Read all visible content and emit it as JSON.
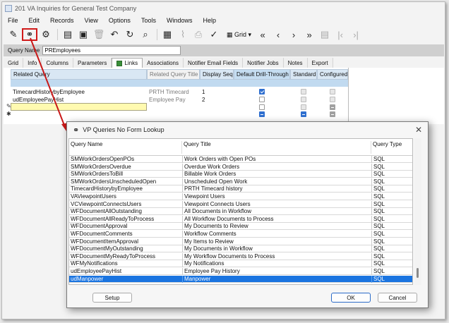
{
  "window": {
    "title": "201 VA Inquiries for General Test Company"
  },
  "menu": [
    "File",
    "Edit",
    "Records",
    "View",
    "Options",
    "Tools",
    "Windows",
    "Help"
  ],
  "toolbar": {
    "grid_label": "Grid"
  },
  "query_name": {
    "label": "Query Name",
    "value": "PREmployees"
  },
  "tabs": [
    "Grid",
    "Info",
    "Columns",
    "Parameters",
    "Links",
    "Associations",
    "Notifier Email Fields",
    "Notifier Jobs",
    "Notes",
    "Export"
  ],
  "links_grid": {
    "headers": [
      "Related Query",
      "Related Query Title",
      "Display Seq",
      "Default Drill-Through",
      "Standard",
      "Configured"
    ],
    "rows": [
      {
        "query": "TimecardHistorybyEmployee",
        "title": "PRTH Timecard",
        "seq": "1"
      },
      {
        "query": "udEmployeePayHist",
        "title": "Employee Pay",
        "seq": "2"
      }
    ]
  },
  "dialog": {
    "title": "VP Queries No Form Lookup",
    "headers": [
      "Query Name",
      "Query Title",
      "Query Type"
    ],
    "rows": [
      {
        "name": "SMWorkOrdersOpenPOs",
        "title": "Work Orders with Open POs",
        "type": "SQL"
      },
      {
        "name": "SMWorkOrdersOverdue",
        "title": "Overdue Work Orders",
        "type": "SQL"
      },
      {
        "name": "SMWorkOrdersToBill",
        "title": "Billable Work Orders",
        "type": "SQL"
      },
      {
        "name": "SMWorkOrdersUnscheduledOpen",
        "title": "Unscheduled Open Work",
        "type": "SQL"
      },
      {
        "name": "TimecardHistorybyEmployee",
        "title": "PRTH Timecard history",
        "type": "SQL"
      },
      {
        "name": "VAViewpointUsers",
        "title": "Viewpoint Users",
        "type": "SQL"
      },
      {
        "name": "VCViewpointConnectsUsers",
        "title": "Viewpoint Connects Users",
        "type": "SQL"
      },
      {
        "name": "WFDocumentAllOutstanding",
        "title": "All Documents in Workflow",
        "type": "SQL"
      },
      {
        "name": "WFDocumentAllReadyToProcess",
        "title": "All Workflow Documents to Process",
        "type": "SQL"
      },
      {
        "name": "WFDocumentApproval",
        "title": "My Documents to Review",
        "type": "SQL"
      },
      {
        "name": "WFDocumentComments",
        "title": "Workflow Comments",
        "type": "SQL"
      },
      {
        "name": "WFDocumentItemApproval",
        "title": "My Items to Review",
        "type": "SQL"
      },
      {
        "name": "WFDocumentMyOutstanding",
        "title": "My Documents in Workflow",
        "type": "SQL"
      },
      {
        "name": "WFDocumentMyReadyToProcess",
        "title": "My Workflow Documents to Process",
        "type": "SQL"
      },
      {
        "name": "WFMyNotifications",
        "title": "My Notifications",
        "type": "SQL"
      },
      {
        "name": "udEmployeePayHist",
        "title": "Employee Pay History",
        "type": "SQL"
      },
      {
        "name": "udManpower",
        "title": "Manpower",
        "type": "SQL"
      }
    ],
    "selected_index": 16,
    "setup_label": "Setup",
    "ok_label": "OK",
    "cancel_label": "Cancel"
  },
  "colors": {
    "selection": "#1a74e0",
    "highlight": "#d01a1a"
  }
}
